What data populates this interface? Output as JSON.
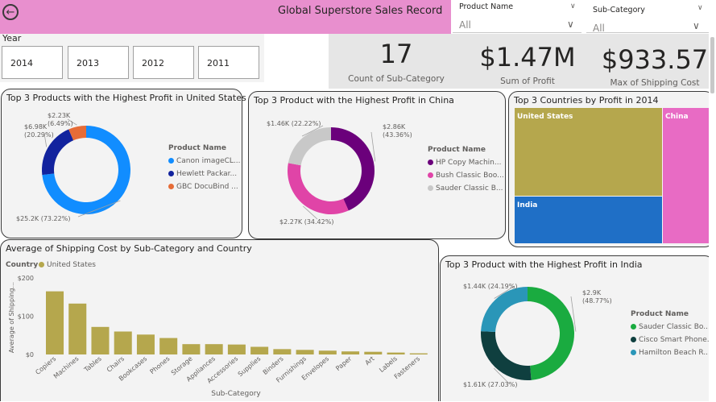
{
  "header": {
    "title": "Global Superstore Sales Record",
    "back_icon": "arrow-left-circle-icon",
    "color": "#e88fce"
  },
  "filters": {
    "product_name": {
      "label": "Product Name",
      "value": "All"
    },
    "sub_category": {
      "label": "Sub-Category",
      "value": "All"
    }
  },
  "year_slicer": {
    "label": "Year",
    "options": [
      "2014",
      "2013",
      "2012",
      "2011"
    ]
  },
  "kpis": [
    {
      "value": "17",
      "label": "Count of Sub-Category"
    },
    {
      "value": "$1.47M",
      "label": "Sum of Profit"
    },
    {
      "value": "$933.57",
      "label": "Max of Shipping Cost"
    }
  ],
  "us_card": {
    "title": "Top 3 Products with the Highest Profit in United States",
    "legend_title": "Product Name",
    "legend": [
      "Canon imageCL...",
      "Hewlett Packar...",
      "GBC DocuBind ..."
    ]
  },
  "china_card": {
    "title": "Top 3 Product with the Highest Profit in China",
    "legend_title": "Product Name",
    "legend": [
      "HP Copy Machin...",
      "Bush Classic Boo...",
      "Sauder Classic B..."
    ]
  },
  "tree_card": {
    "title": "Top 3 Countries by Profit in 2014"
  },
  "bar_card": {
    "title": "Average of Shipping Cost by Sub-Category and Country",
    "legend_title": "Country",
    "legend_item": "United States"
  },
  "india_card": {
    "title": "Top 3 Product with the Highest Profit in India",
    "legend_title": "Product Name",
    "legend": [
      "Sauder Classic Bo...",
      "Cisco Smart Phone...",
      "Hamilton Beach R..."
    ]
  },
  "chart_data": [
    {
      "type": "pie",
      "title": "Top 3 Products with the Highest Profit in United States",
      "categories": [
        "Canon imageCL...",
        "Hewlett Packar...",
        "GBC DocuBind ..."
      ],
      "values": [
        25.2,
        6.98,
        2.23
      ],
      "value_labels": [
        "$25.2K (73.22%)",
        "$6.98K (20.29%)",
        "$2.23K (6.49%)"
      ],
      "colors": [
        "#118dff",
        "#12239e",
        "#e66c37"
      ]
    },
    {
      "type": "pie",
      "title": "Top 3 Product with the Highest Profit in China",
      "categories": [
        "HP Copy Machin...",
        "Bush Classic Boo...",
        "Sauder Classic B..."
      ],
      "values": [
        2.86,
        2.27,
        1.46
      ],
      "value_labels": [
        "$2.86K (43.36%)",
        "$2.27K (34.42%)",
        "$1.46K (22.22%)"
      ],
      "colors": [
        "#6b007b",
        "#e044a7",
        "#c8c8c8"
      ]
    },
    {
      "type": "heatmap",
      "title": "Top 3 Countries by Profit in 2014",
      "categories": [
        "United States",
        "China",
        "India"
      ],
      "colors": [
        "#b5a74d",
        "#e86bc4",
        "#1f6fc6"
      ]
    },
    {
      "type": "bar",
      "title": "Average of Shipping Cost by Sub-Category and Country",
      "xlabel": "Sub-Category",
      "ylabel": "Average of Shipping...",
      "ylim": [
        0,
        200
      ],
      "yticks": [
        "$0",
        "$100",
        "$200"
      ],
      "series": [
        {
          "name": "United States",
          "color": "#b5a74d",
          "values": [
            165,
            133,
            72,
            60,
            52,
            43,
            27,
            27,
            26,
            20,
            14,
            12,
            10,
            8,
            7,
            5,
            3
          ]
        }
      ],
      "categories": [
        "Copiers",
        "Machines",
        "Tables",
        "Chairs",
        "Bookcases",
        "Phones",
        "Storage",
        "Appliances",
        "Accessories",
        "Supplies",
        "Binders",
        "Furnishings",
        "Envelopes",
        "Paper",
        "Art",
        "Labels",
        "Fasteners"
      ]
    },
    {
      "type": "pie",
      "title": "Top 3 Product with the Highest Profit in India",
      "categories": [
        "Sauder Classic Bo...",
        "Cisco Smart Phone...",
        "Hamilton Beach R..."
      ],
      "values": [
        2.9,
        1.61,
        1.44
      ],
      "value_labels": [
        "$2.9K (48.77%)",
        "$1.61K (27.03%)",
        "$1.44K (24.19%)"
      ],
      "colors": [
        "#1aab40",
        "#0f3f3f",
        "#2a96b8"
      ]
    }
  ]
}
